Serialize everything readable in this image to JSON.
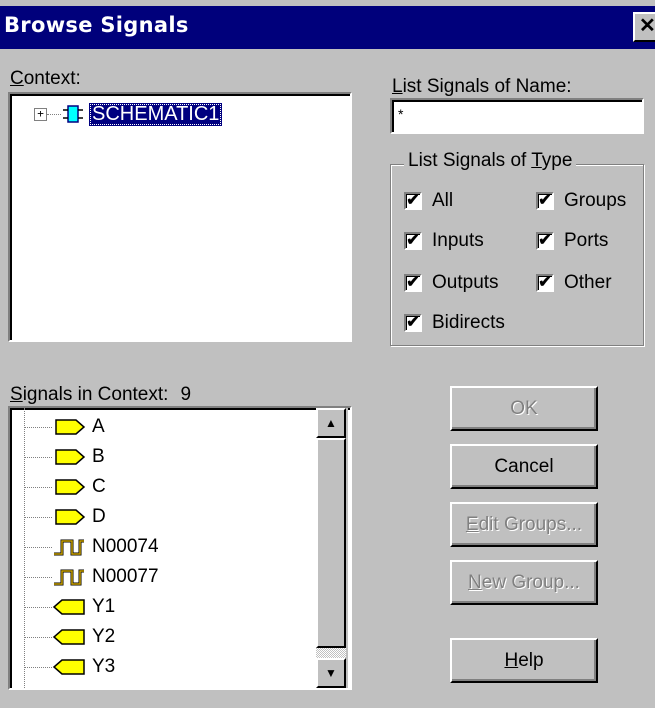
{
  "window": {
    "title": "Browse Signals",
    "close_glyph": "✕"
  },
  "context": {
    "label": "Context:",
    "tree_root": "SCHEMATIC1",
    "expand_glyph": "+"
  },
  "list_name": {
    "label": "List Signals of Name:",
    "value": "*"
  },
  "type_group": {
    "label": "List Signals of Type",
    "options": [
      {
        "label": "All",
        "checked": true
      },
      {
        "label": "Groups",
        "checked": true
      },
      {
        "label": "Inputs",
        "checked": true
      },
      {
        "label": "Ports",
        "checked": true
      },
      {
        "label": "Outputs",
        "checked": true
      },
      {
        "label": "Other",
        "checked": true
      },
      {
        "label": "Bidirects",
        "checked": true
      }
    ]
  },
  "signals": {
    "label": "Signals in Context:",
    "count": "9",
    "items": [
      {
        "name": "A",
        "icon": "input-signal-icon"
      },
      {
        "name": "B",
        "icon": "input-signal-icon"
      },
      {
        "name": "C",
        "icon": "input-signal-icon"
      },
      {
        "name": "D",
        "icon": "input-signal-icon"
      },
      {
        "name": "N00074",
        "icon": "pulse-signal-icon"
      },
      {
        "name": "N00077",
        "icon": "pulse-signal-icon"
      },
      {
        "name": "Y1",
        "icon": "output-signal-icon"
      },
      {
        "name": "Y2",
        "icon": "output-signal-icon"
      },
      {
        "name": "Y3",
        "icon": "output-signal-icon"
      }
    ]
  },
  "buttons": {
    "ok": "OK",
    "cancel": "Cancel",
    "edit_groups": "Edit Groups...",
    "new_group": "New Group...",
    "help": "Help"
  },
  "colors": {
    "title_bar": "#00007b",
    "face": "#c0c0c0",
    "selection": "#000080",
    "signal_icon": "#ffff00"
  }
}
